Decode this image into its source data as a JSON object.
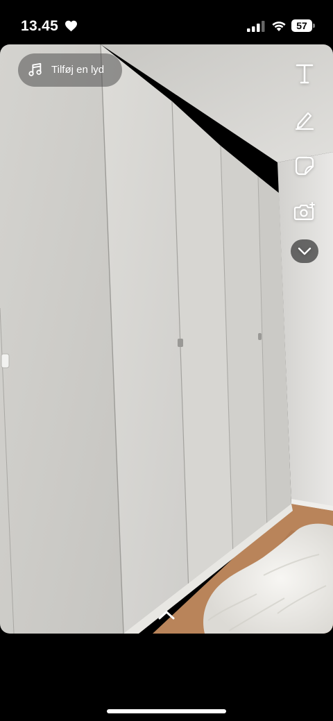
{
  "status_bar": {
    "time": "13.45",
    "battery": "57",
    "icons": [
      "heart-icon",
      "cellular-signal-icon",
      "wifi-icon",
      "battery-icon"
    ]
  },
  "snap": {
    "add_sound_label": "Tilføj en lyd",
    "tools": [
      "text-tool-icon",
      "pen-tool-icon",
      "sticker-tool-icon",
      "camera-tool-icon",
      "chevron-down-icon"
    ],
    "swipe_hint_icon": "chevron-up-icon"
  },
  "colors": {
    "background": "#000000",
    "pill": "#505050",
    "wall": "#d9d8d5",
    "floor": "#b9845a"
  }
}
